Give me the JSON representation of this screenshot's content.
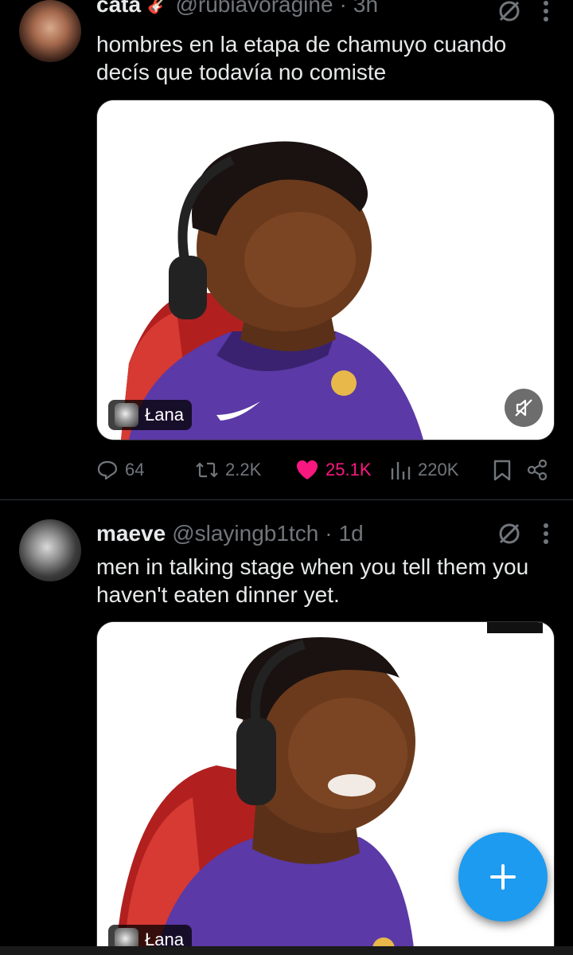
{
  "colors": {
    "background": "#000000",
    "text": "#e7e9ea",
    "muted": "#71767b",
    "like": "#f91880",
    "accent": "#1d9bf0",
    "divider": "#2f3336"
  },
  "tweets": [
    {
      "name": "cata",
      "emoji": "🎸",
      "handle": "@rubiavoragine",
      "dot": "·",
      "time": "3h",
      "text": "hombres en la etapa de chamuyo cuando decís que todavía no comiste",
      "media_label": "Łana",
      "media_description_icon": "person-with-headphones-image",
      "stats": {
        "replies": "64",
        "retweets": "2.2K",
        "likes": "25.1K",
        "views": "220K"
      },
      "liked": true
    },
    {
      "name": "maeve",
      "handle": "@slayingb1tch",
      "dot": "·",
      "time": "1d",
      "text": "men in talking stage when you tell them you haven't eaten dinner yet.",
      "media_label": "Łana"
    }
  ],
  "icons": {
    "grok": "grok-icon",
    "more": "more-vertical-icon",
    "reply": "reply-icon",
    "retweet": "retweet-icon",
    "like": "heart-icon",
    "views": "views-icon",
    "bookmark": "bookmark-icon",
    "share": "share-icon",
    "mute": "muted-speaker-icon",
    "compose": "plus-icon"
  }
}
